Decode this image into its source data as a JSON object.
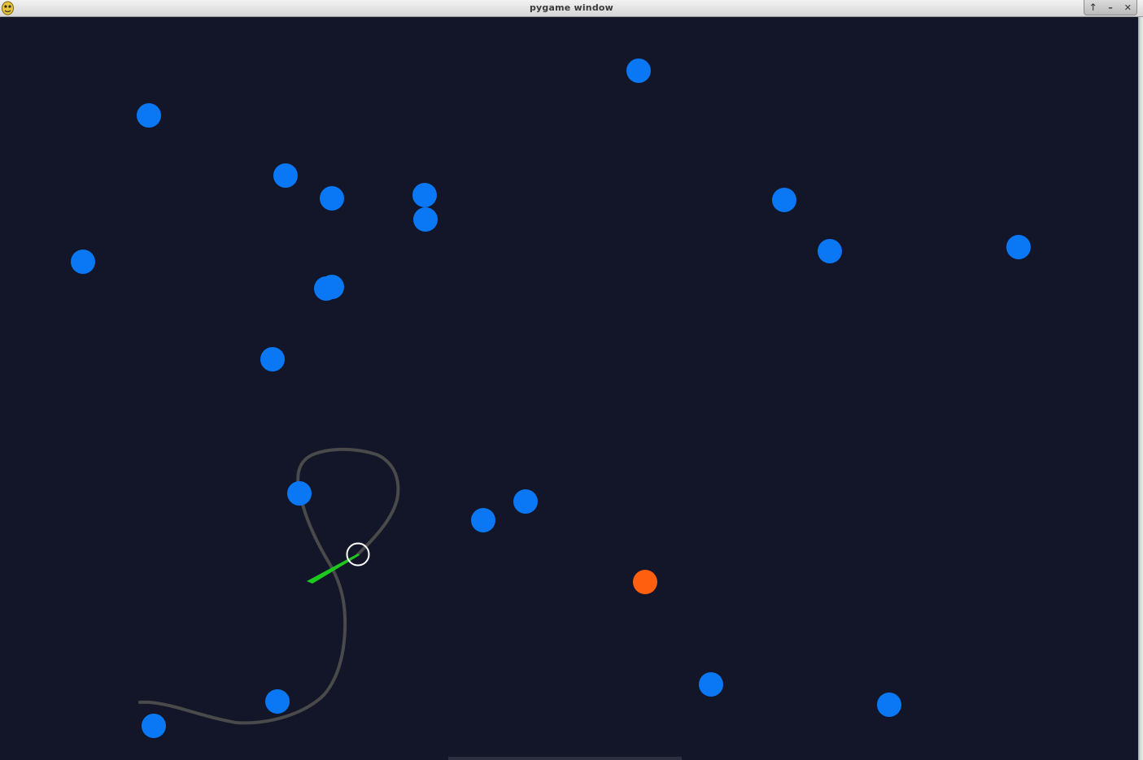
{
  "window": {
    "title": "pygame window",
    "app_icon": "pygame-snake-icon",
    "controls": [
      {
        "name": "maximize-button",
        "icon": "arrow-up-icon",
        "glyph": "🡑"
      },
      {
        "name": "minimize-button",
        "icon": "minimize-icon",
        "glyph": "–"
      },
      {
        "name": "close-button",
        "icon": "close-icon",
        "glyph": "✕"
      }
    ]
  },
  "colors": {
    "background": "#131629",
    "food": "#0a78f5",
    "target": "#ff5f0f",
    "trail": "#4a4a4a",
    "heading": "#1ec81e",
    "agent_ring": "#ffffff"
  }
}
